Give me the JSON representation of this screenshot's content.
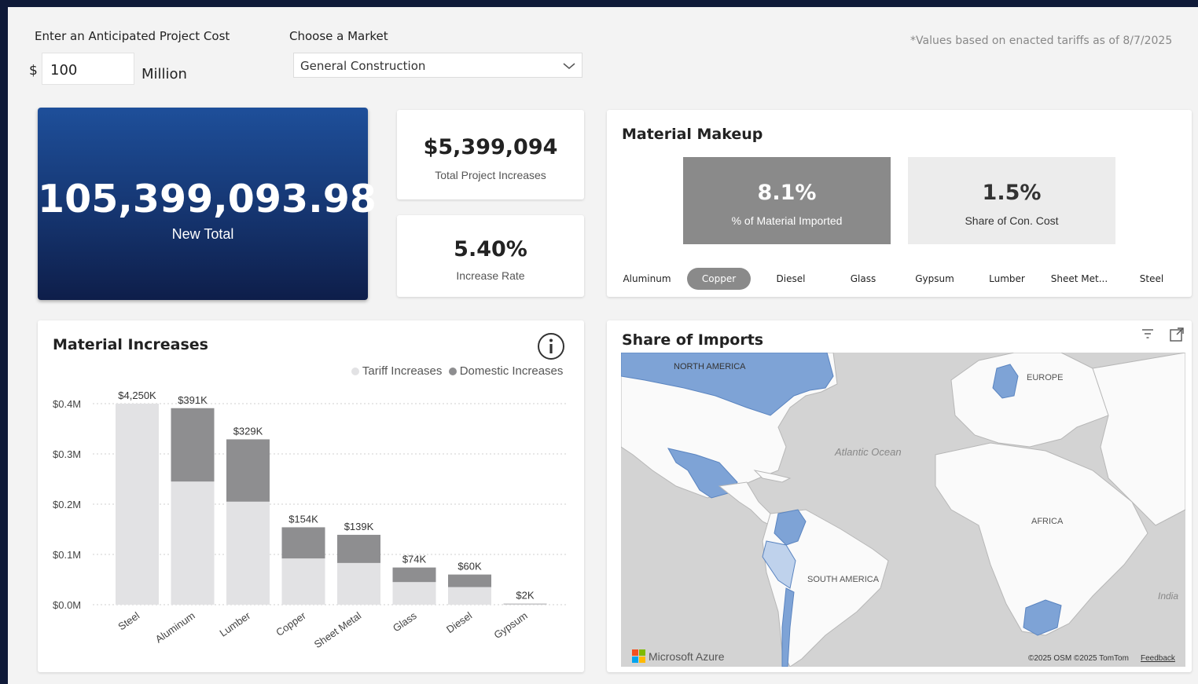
{
  "inputs": {
    "cost_label": "Enter an Anticipated Project Cost",
    "currency": "$",
    "cost_value": "100",
    "unit": "Million",
    "market_label": "Choose a Market",
    "market_value": "General Construction",
    "note": "*Values based on enacted tariffs as of 8/7/2025"
  },
  "hero": {
    "value": "105,399,093.98",
    "label": "New Total"
  },
  "kpis": {
    "total_increase": {
      "value": "$5,399,094",
      "label": "Total Project Increases"
    },
    "increase_rate": {
      "value": "5.40%",
      "label": "Increase Rate"
    }
  },
  "material_makeup": {
    "title": "Material Makeup",
    "imported": {
      "value": "8.1%",
      "label": "% of Material Imported"
    },
    "share": {
      "value": "1.5%",
      "label": "Share of Con. Cost"
    },
    "chips": [
      "Aluminum",
      "Copper",
      "Diesel",
      "Glass",
      "Gypsum",
      "Lumber",
      "Sheet Met...",
      "Steel"
    ],
    "selected": "Copper"
  },
  "material_increases": {
    "title": "Material Increases",
    "info_icon": "info-icon",
    "legend": [
      "Tariff Increases",
      "Domestic Increases"
    ],
    "colors": {
      "tariff": "#8e8e90",
      "domestic": "#e2e2e4"
    }
  },
  "chart_data": {
    "type": "bar",
    "stacked": true,
    "categories": [
      "Steel",
      "Aluminum",
      "Lumber",
      "Copper",
      "Sheet Metal",
      "Glass",
      "Diesel",
      "Gypsum"
    ],
    "series": [
      {
        "name": "Domestic Increases",
        "values": [
          0.4,
          0.245,
          0.205,
          0.092,
          0.083,
          0.045,
          0.035,
          0.001
        ]
      },
      {
        "name": "Tariff Increases",
        "values": [
          0.0,
          0.146,
          0.124,
          0.062,
          0.056,
          0.029,
          0.025,
          0.001
        ]
      }
    ],
    "data_labels": [
      "$4,250K",
      "$391K",
      "$329K",
      "$154K",
      "$139K",
      "$74K",
      "$60K",
      "$2K"
    ],
    "y_ticks": [
      "$0.0M",
      "$0.1M",
      "$0.2M",
      "$0.3M",
      "$0.4M"
    ],
    "ylim": [
      0,
      0.4
    ],
    "grid": true,
    "legend_position": "top-right"
  },
  "share_of_imports": {
    "title": "Share of Imports",
    "labels": {
      "north_america": "NORTH AMERICA",
      "europe": "EUROPE",
      "atlantic": "Atlantic Ocean",
      "africa": "AFRICA",
      "south_america": "SOUTH AMERICA",
      "india": "India"
    },
    "azure": "Microsoft Azure",
    "copyright": "©2025 OSM ©2025 TomTom",
    "feedback": "Feedback",
    "colors": {
      "land": "#fafafa",
      "water": "#d3d3d3",
      "highlight": "#7ea3d6"
    }
  }
}
